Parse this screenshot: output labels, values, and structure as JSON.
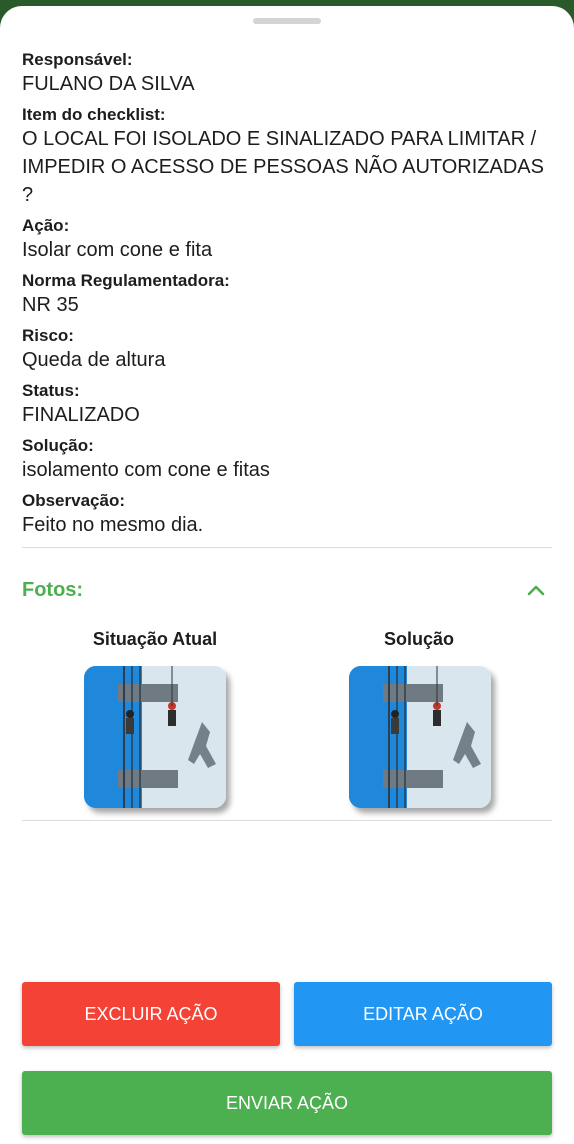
{
  "fields": [
    {
      "label": "Responsável:",
      "value": "FULANO DA SILVA"
    },
    {
      "label": "Item do checklist:",
      "value": "O LOCAL FOI ISOLADO E SINALIZADO PARA LIMITAR / IMPEDIR O ACESSO DE PESSOAS NÃO AUTORIZADAS ?"
    },
    {
      "label": "Ação:",
      "value": "Isolar com cone e fita"
    },
    {
      "label": "Norma Regulamentadora:",
      "value": "NR 35"
    },
    {
      "label": "Risco:",
      "value": "Queda de altura"
    },
    {
      "label": "Status:",
      "value": "FINALIZADO"
    },
    {
      "label": "Solução:",
      "value": "isolamento com cone e fitas"
    },
    {
      "label": "Observação:",
      "value": "Feito no mesmo dia."
    }
  ],
  "fotos": {
    "title": "Fotos:",
    "toggle_icon": "chevron-up-icon",
    "accent_color": "#4caf50",
    "items": [
      {
        "caption": "Situação Atual"
      },
      {
        "caption": "Solução"
      }
    ]
  },
  "buttons": {
    "delete_label": "EXCLUIR AÇÃO",
    "delete_color": "#f44336",
    "edit_label": "EDITAR AÇÃO",
    "edit_color": "#2196f3",
    "send_label": "ENVIAR AÇÃO",
    "send_color": "#4caf50"
  }
}
